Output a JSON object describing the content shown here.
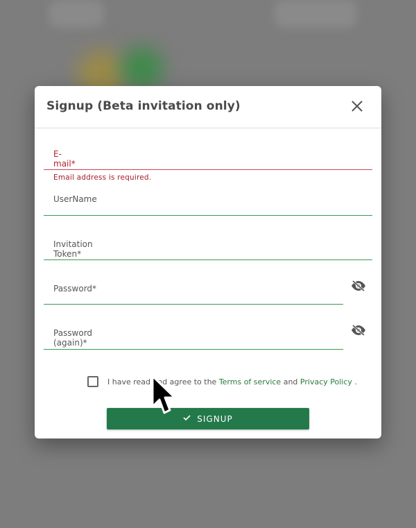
{
  "dialog": {
    "title": "Signup (Beta invitation only)",
    "close_icon": "close-icon"
  },
  "form": {
    "email": {
      "label": "E-mail*",
      "error": "Email address is required."
    },
    "username": {
      "label": "UserName"
    },
    "token": {
      "label": "Invitation Token*"
    },
    "password": {
      "label": "Password*",
      "toggle_icon": "eye-off-icon"
    },
    "password_again": {
      "label": "Password (again)*",
      "toggle_icon": "eye-off-icon"
    }
  },
  "terms": {
    "prefix": "I have read and agree to the ",
    "terms_link": "Terms of service",
    "middle": " and ",
    "privacy_link": "Privacy Policy",
    "suffix": " ."
  },
  "submit": {
    "label": "SIGNUP",
    "icon": "check-icon"
  },
  "colors": {
    "accent": "#23794a",
    "error": "#b3212f",
    "link": "#2a7a3a",
    "overlay": "#7d7d7d"
  }
}
